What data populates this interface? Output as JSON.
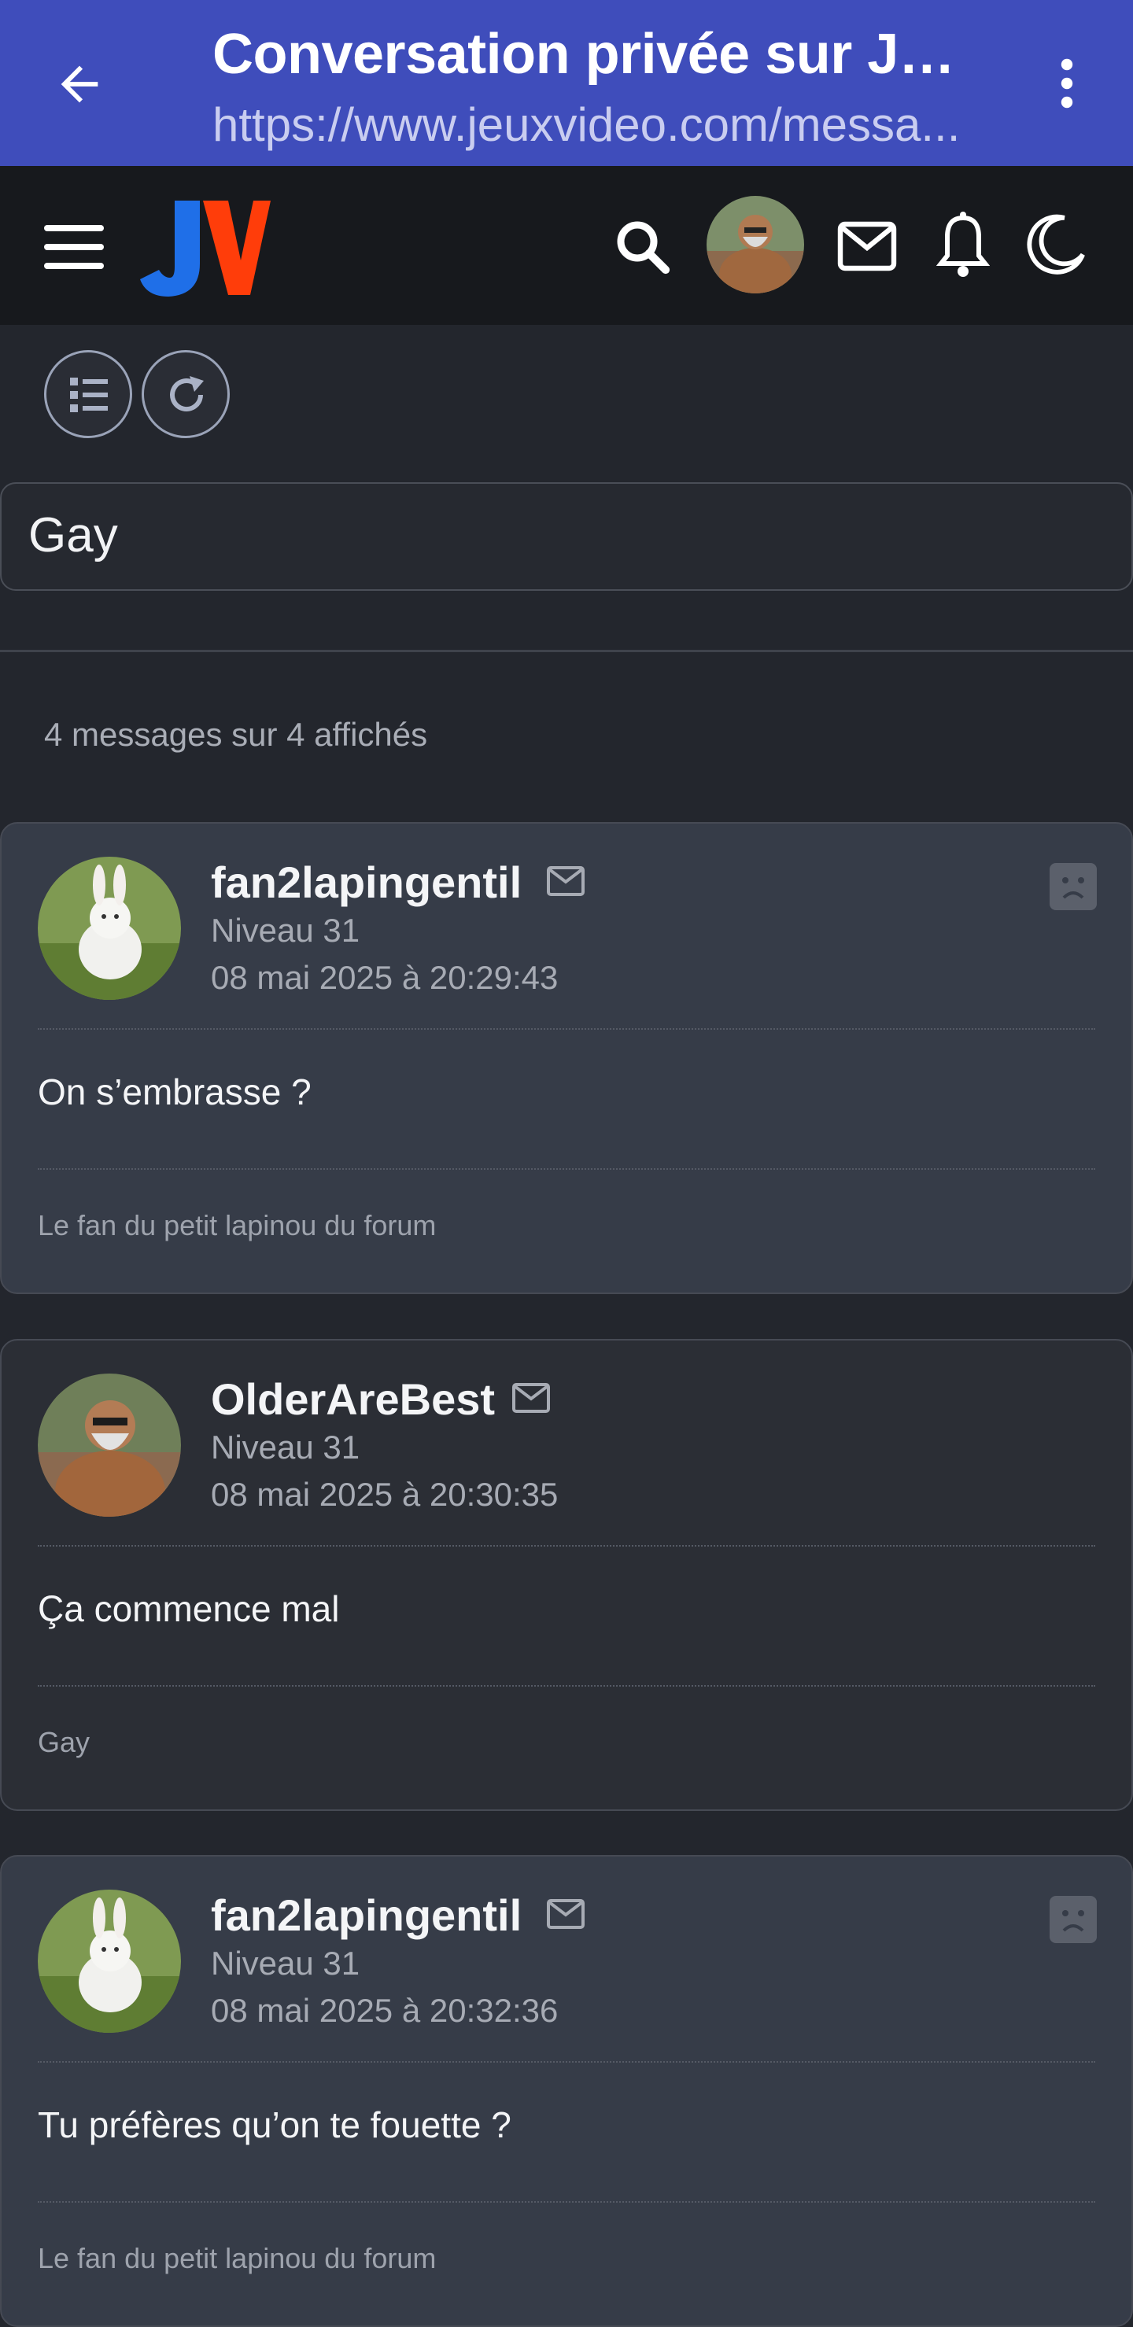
{
  "browser_bar": {
    "title": "Conversation privée sur Je...",
    "url": "https://www.jeuxvideo.com/messa..."
  },
  "header": {
    "logo_text": "JV",
    "icons": [
      "menu-icon",
      "search-icon",
      "user-avatar",
      "mail-icon",
      "bell-icon",
      "moon-icon"
    ]
  },
  "toolbar": {
    "icons": [
      "list-icon",
      "refresh-icon"
    ]
  },
  "conversation": {
    "subject": "Gay",
    "count_text": "4 messages sur 4 affichés"
  },
  "messages": [
    {
      "author": "fan2lapingentil",
      "level": "Niveau 31",
      "date": "08 mai 2025 à 20:29:43",
      "body": "On s’embrasse ?",
      "signature": "Le fan du petit lapinou du forum",
      "avatar": "rabbit"
    },
    {
      "author": "OlderAreBest",
      "level": "Niveau 31",
      "date": "08 mai 2025 à 20:30:35",
      "body": "Ça commence mal",
      "signature": "Gay",
      "avatar": "man"
    },
    {
      "author": "fan2lapingentil",
      "level": "Niveau 31",
      "date": "08 mai 2025 à 20:32:36",
      "body": "Tu préfères qu’on te fouette ?",
      "signature": "Le fan du petit lapinou du forum",
      "avatar": "rabbit"
    }
  ],
  "colors": {
    "browser_bar": "#3f4dbb",
    "header": "#17191d",
    "page": "#23262d",
    "logo_blue": "#1f6fe8",
    "logo_red": "#ff3d0a"
  }
}
